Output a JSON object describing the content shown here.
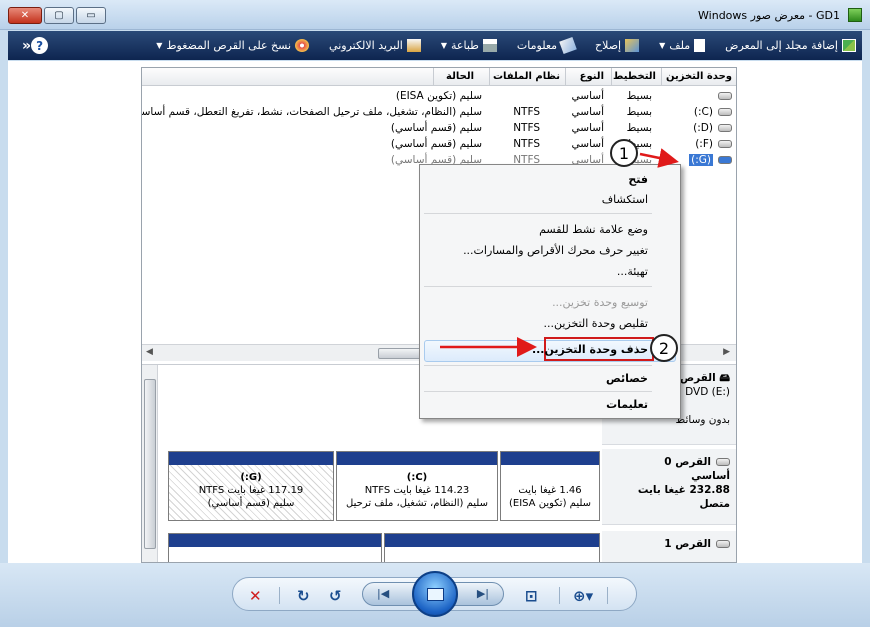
{
  "window": {
    "title": "GD1 - معرض صور Windows",
    "minimize_glyph": "▭",
    "maximize_glyph": "▢",
    "close_glyph": "✕"
  },
  "toolbar": {
    "items": [
      {
        "label": "إضافة مجلد إلى المعرض",
        "icon": "add-folder-icon",
        "dropdown": false
      },
      {
        "label": "ملف",
        "icon": "file-icon",
        "dropdown": true
      },
      {
        "label": "إصلاح",
        "icon": "fix-icon",
        "dropdown": false
      },
      {
        "label": "معلومات",
        "icon": "info-icon",
        "dropdown": false
      },
      {
        "label": "طباعة",
        "icon": "print-icon",
        "dropdown": true
      },
      {
        "label": "البريد الالكتروني",
        "icon": "email-icon",
        "dropdown": false
      },
      {
        "label": "نسخ على القرص المضغوط",
        "icon": "burn-icon",
        "dropdown": true
      }
    ],
    "more_glyph": "«",
    "help_glyph": "?"
  },
  "volume_table": {
    "headers": [
      "وحدة التخزين",
      "التخطيط",
      "النوع",
      "نظام الملفات",
      "الحالة"
    ],
    "rows": [
      {
        "volume": "",
        "layout": "بسيط",
        "type": "أساسي",
        "fs": "",
        "status": "سليم (تكوين EISA)"
      },
      {
        "volume": "(C:)",
        "layout": "بسيط",
        "type": "أساسي",
        "fs": "NTFS",
        "status": "سليم (النظام، تشغيل، ملف ترحيل الصفحات، نشط، تفريغ التعطل، قسم أساسي)"
      },
      {
        "volume": "(D:)",
        "layout": "بسيط",
        "type": "أساسي",
        "fs": "NTFS",
        "status": "سليم (قسم أساسي)"
      },
      {
        "volume": "(F:)",
        "layout": "بسيط",
        "type": "أساسي",
        "fs": "NTFS",
        "status": "سليم (قسم أساسي)"
      },
      {
        "volume": "(G:)",
        "layout": "بسيط",
        "type": "أساسي",
        "fs": "NTFS",
        "status": "سليم (قسم أساسي)"
      }
    ]
  },
  "context_menu": {
    "items": [
      {
        "label": "فتح",
        "state": "bold"
      },
      {
        "label": "استكشاف",
        "state": "normal"
      },
      {
        "label": "وضع علامة نشط للقسم",
        "state": "normal"
      },
      {
        "label": "تغيير حرف محرك الأقراص والمسارات...",
        "state": "normal"
      },
      {
        "label": "تهيئة...",
        "state": "normal"
      },
      {
        "label": "توسيع وحدة تخزين...",
        "state": "disabled"
      },
      {
        "label": "تقليص وحدة التخزين...",
        "state": "normal"
      },
      {
        "label": "حذف وحدة التخزين...",
        "state": "highlighted"
      },
      {
        "label": "خصائص",
        "state": "normal"
      },
      {
        "label": "تعليمات",
        "state": "normal"
      }
    ]
  },
  "disk_map": {
    "dvd": {
      "title": "القرص",
      "line1": "DVD (E:)",
      "line2": "بدون وسائط"
    },
    "disk0": {
      "title": "القرص 0",
      "type": "أساسي",
      "size": "232.88 غيغا بايت",
      "state": "متصل"
    },
    "disk1": {
      "title": "القرص 1"
    },
    "volumes": [
      {
        "name": "",
        "size": "1.46 غيغا بايت",
        "status": "سليم (تكوين EISA)"
      },
      {
        "name": "(C:)",
        "size": "114.23 غيغا بايت NTFS",
        "status": "سليم (النظام، تشغيل، ملف ترحيل"
      },
      {
        "name": "(G:)",
        "size": "117.19 غيغا بايت NTFS",
        "status": "سليم (قسم أساسي)"
      }
    ]
  },
  "annotations": {
    "step1": "1",
    "step2": "2"
  },
  "controls": {
    "delete_glyph": "✕",
    "rotate_cw_glyph": "↻",
    "rotate_ccw_glyph": "↺",
    "prev_glyph": "|◀",
    "next_glyph": "▶|",
    "fit_glyph": "⊡",
    "zoom_glyph": "⊕▾"
  },
  "colors": {
    "accent": "#1e3f8e",
    "highlight_arrow": "#e01a1a",
    "selection": "#3a78d4"
  }
}
